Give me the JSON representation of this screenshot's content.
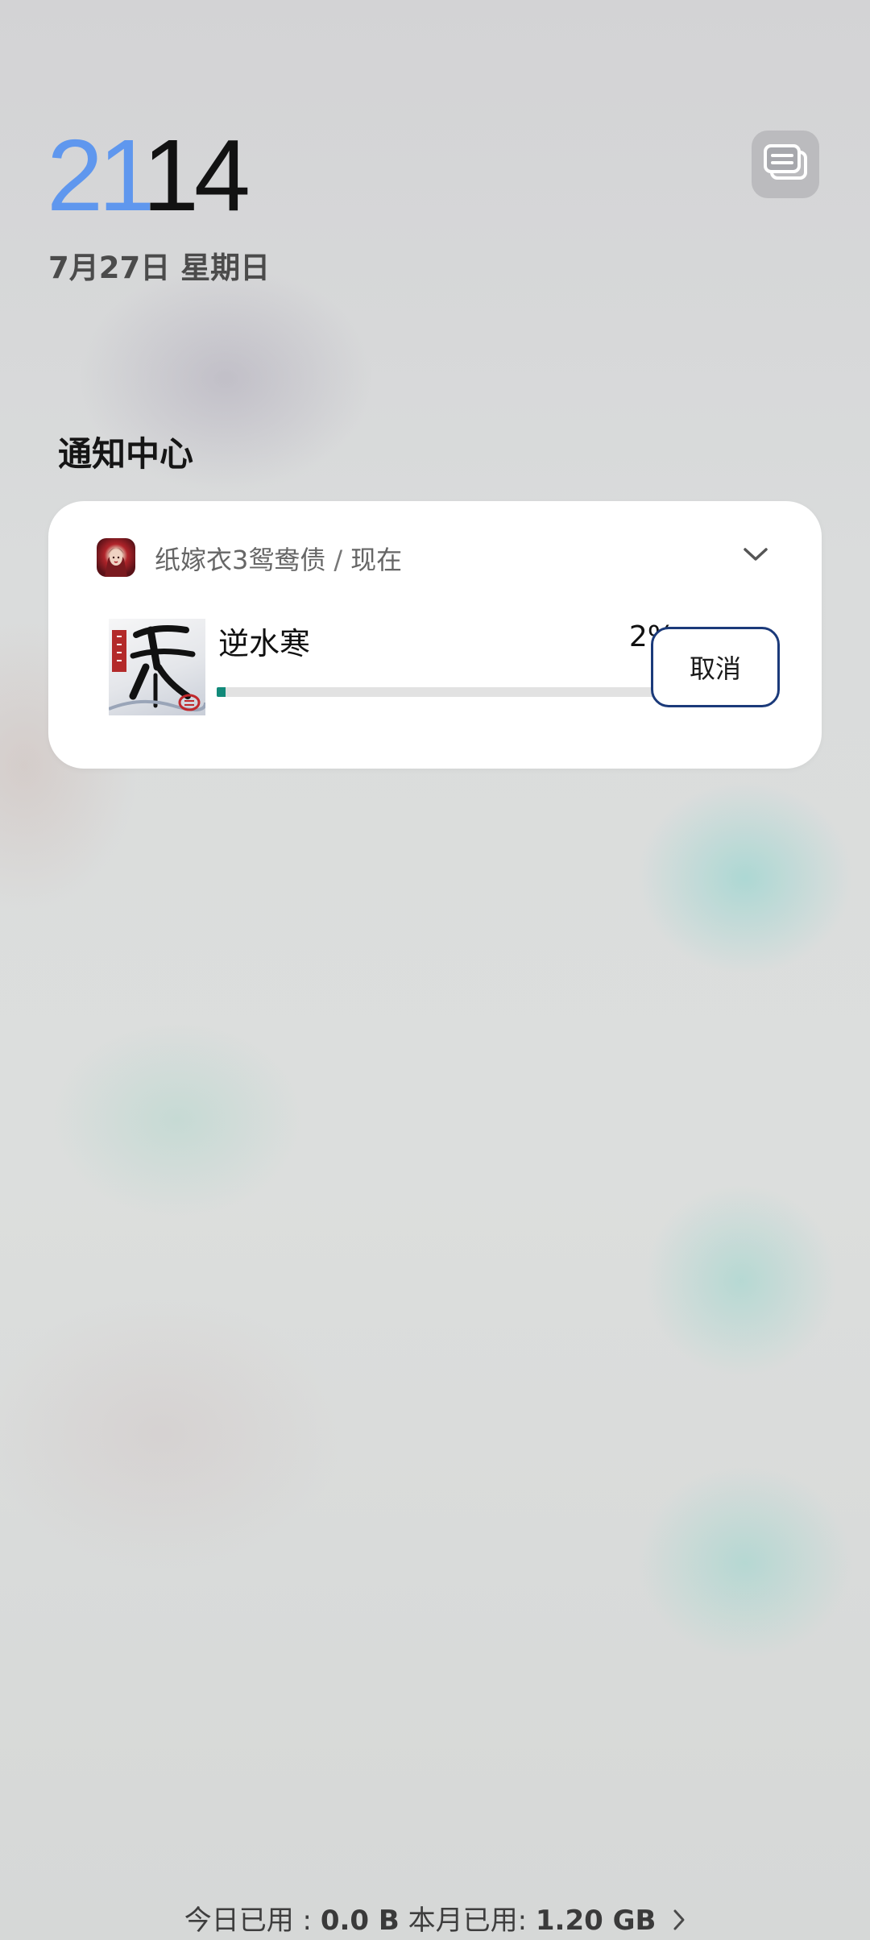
{
  "clock": {
    "hours": "21",
    "minutes": "14"
  },
  "date": "7月27日 星期日",
  "notification_center": {
    "title": "通知中心"
  },
  "notification": {
    "app_name": "纸嫁衣3鸳鸯债",
    "separator": "/",
    "time": "现在",
    "download": {
      "title": "逆水寒",
      "percent_label": "2%",
      "progress": 0.02,
      "cancel_label": "取消"
    }
  },
  "footer": {
    "today_label": "今日已用 : ",
    "today_value": "0.0 B",
    "month_label": "本月已用: ",
    "month_value": "1.20 GB"
  },
  "colors": {
    "clock_hours": "#5f97ee",
    "progress_fill": "#128a7a",
    "cancel_border": "#1b3a7a"
  },
  "icons": [
    "notification-manage-icon",
    "app-icon",
    "chevron-down-icon",
    "game-thumbnail",
    "chevron-right-icon"
  ]
}
